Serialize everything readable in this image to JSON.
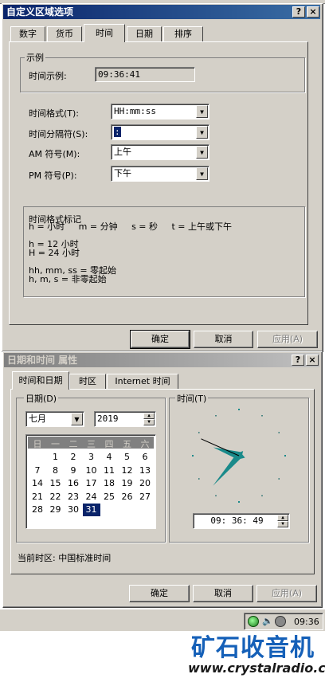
{
  "dialog1": {
    "title": "自定义区域选项",
    "help_btn": "?",
    "close_btn": "×",
    "tabs": [
      "数字",
      "货币",
      "时间",
      "日期",
      "排序"
    ],
    "sample_group": "示例",
    "sample_label": "时间示例:",
    "sample_value": "09:36:41",
    "fields": [
      {
        "label": "时间格式(T):",
        "value": "HH:mm:ss"
      },
      {
        "label": "时间分隔符(S):",
        "value": ":"
      },
      {
        "label": "AM 符号(M):",
        "value": "上午"
      },
      {
        "label": "PM 符号(P):",
        "value": "下午"
      }
    ],
    "notation_title": "时间格式标记",
    "notation_lines": [
      "h = 小时     m = 分钟     s = 秒     t = 上午或下午",
      "",
      "h = 12 小时",
      "H = 24 小时",
      "",
      "hh, mm, ss = 零起始",
      "h, m, s = 非零起始"
    ],
    "ok": "确定",
    "cancel": "取消",
    "apply": "应用(A)"
  },
  "dialog2": {
    "title": "日期和时间 属性",
    "help_btn": "?",
    "close_btn": "×",
    "tabs": [
      "时间和日期",
      "时区",
      "Internet 时间"
    ],
    "date_group": "日期(D)",
    "month": "七月",
    "year": "2019",
    "weekdays": [
      "日",
      "一",
      "二",
      "三",
      "四",
      "五",
      "六"
    ],
    "selected_day": "31",
    "time_group": "时间(T)",
    "time_value": "09: 36: 49",
    "timezone_text": "当前时区: 中国标准时间",
    "ok": "确定",
    "cancel": "取消",
    "apply": "应用(A)"
  },
  "taskbar": {
    "clock": "09:36"
  },
  "watermark": {
    "brand": "矿石收音机",
    "url": "www.crystalradio.cn"
  },
  "colors": {
    "title_active": "#0a246a",
    "title_inactive": "#808080",
    "face": "#d4d0c8",
    "hand": "#1a8a8a",
    "selected": "#0a246a",
    "brand": "#1560b8"
  },
  "calendar_rows": [
    [
      "",
      "1",
      "2",
      "3",
      "4",
      "5",
      "6"
    ],
    [
      "7",
      "8",
      "9",
      "10",
      "11",
      "12",
      "13"
    ],
    [
      "14",
      "15",
      "16",
      "17",
      "18",
      "19",
      "20"
    ],
    [
      "21",
      "22",
      "23",
      "24",
      "25",
      "26",
      "27"
    ],
    [
      "28",
      "29",
      "30",
      "31",
      "",
      "",
      ""
    ]
  ],
  "clock": {
    "hours": 9,
    "minutes": 36,
    "seconds": 49
  }
}
